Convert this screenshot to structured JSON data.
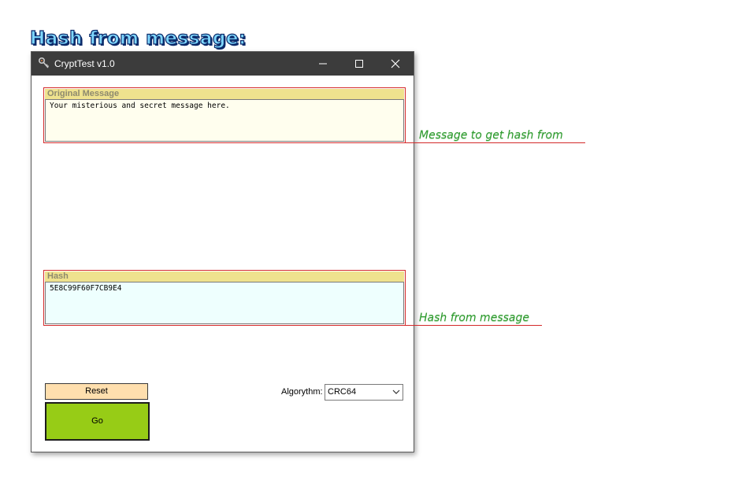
{
  "heading": "Hash from message:",
  "window": {
    "title": "CryptTest v1.0",
    "icon": "app-key-icon",
    "controls": [
      "minimize-icon",
      "maximize-icon",
      "close-icon"
    ]
  },
  "original_message": {
    "label": "Original Message",
    "value": "Your misterious and secret message here."
  },
  "hash": {
    "label": "Hash",
    "value": "5E8C99F60F7CB9E4"
  },
  "buttons": {
    "reset": "Reset",
    "go": "Go"
  },
  "algorithm": {
    "label": "Algorythm:",
    "selected": "CRC64"
  },
  "annotations": {
    "message": "Message to get hash from",
    "hash": "Hash from message"
  },
  "colors": {
    "titlebar": "#3c3c3c",
    "group_border": "#d42a2a",
    "group_header": "#efe28e",
    "message_bg": "#fffeee",
    "hash_bg": "#eefffe",
    "reset_bg": "#ffdfae",
    "go_bg": "#97cc16",
    "annotation_text": "#2e9a2e",
    "heading_fill": "#7fd8ff"
  }
}
